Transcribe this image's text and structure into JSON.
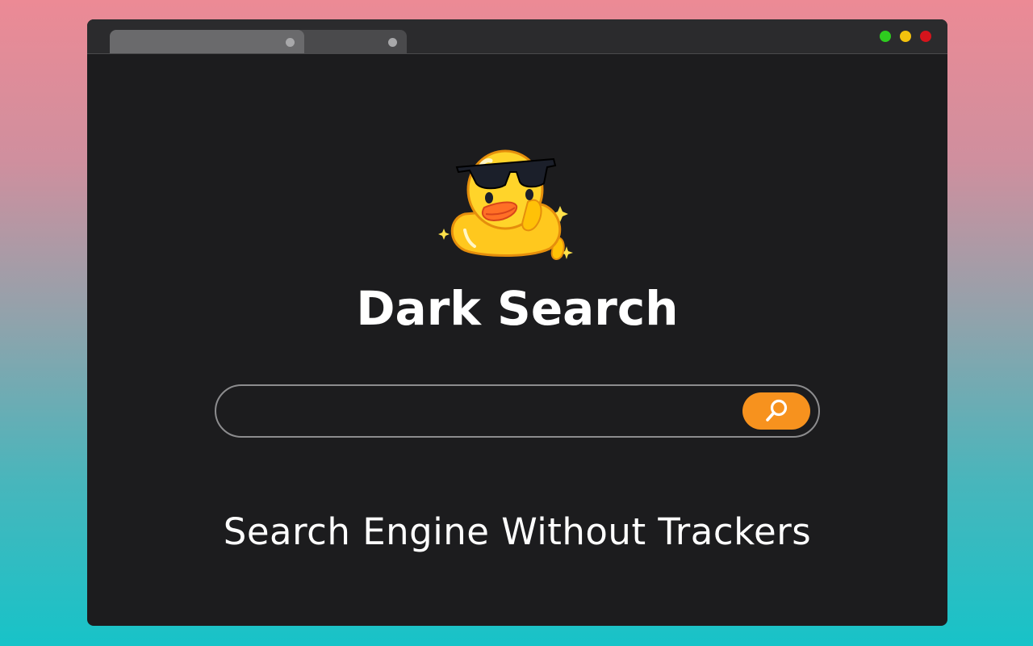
{
  "page": {
    "title": "Dark Search",
    "tagline": "Search Engine Without Trackers"
  },
  "search": {
    "value": "",
    "placeholder": ""
  },
  "icons": {
    "logo": "duck-with-sunglasses-icon",
    "search_button": "magnifier-icon"
  },
  "colors": {
    "accent": "#f7921e",
    "background": "#1c1c1e",
    "window_controls": [
      "#2ecc1f",
      "#f4c20d",
      "#d6141c"
    ]
  }
}
